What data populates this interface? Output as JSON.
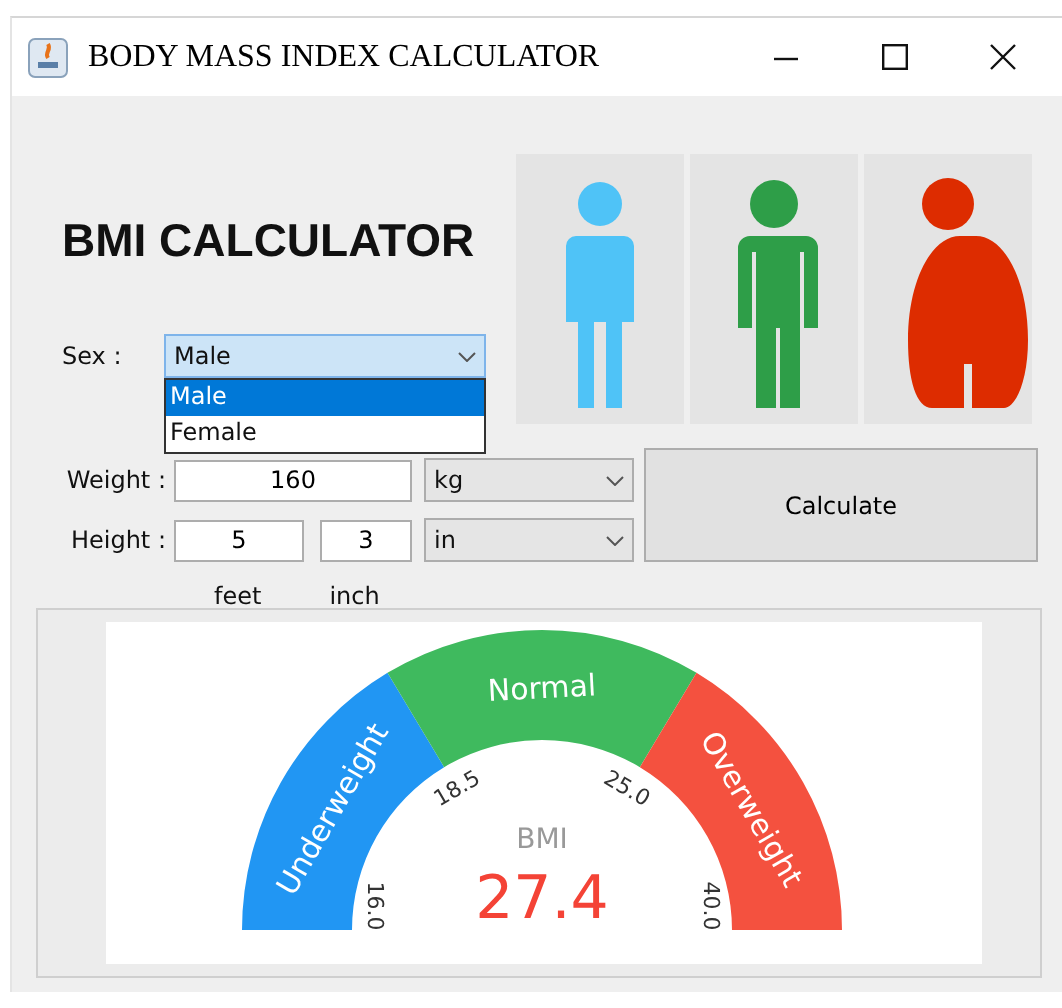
{
  "window": {
    "title": "BODY MASS INDEX CALCULATOR"
  },
  "heading": "BMI CALCULATOR",
  "figures": [
    {
      "kind": "slim",
      "color": "#4fc3f7"
    },
    {
      "kind": "normal",
      "color": "#2e9e48"
    },
    {
      "kind": "heavy",
      "color": "#dd2c00"
    }
  ],
  "sex": {
    "label": "Sex :",
    "value": "Male",
    "expanded": true,
    "options": [
      {
        "label": "Male",
        "selected": true
      },
      {
        "label": "Female",
        "selected": false
      }
    ]
  },
  "weight": {
    "label": "Weight :",
    "value": "160",
    "unit": "kg"
  },
  "height": {
    "label": "Height :",
    "feet": "5",
    "inch": "3",
    "unit": "in",
    "feet_caption": "feet",
    "inch_caption": "inch"
  },
  "calculate_button": "Calculate",
  "gauge": {
    "segments": [
      {
        "label": "Underweight",
        "color": "#2196f3"
      },
      {
        "label": "Normal",
        "color": "#3fba5e"
      },
      {
        "label": "Overweight",
        "color": "#f4513f"
      }
    ],
    "ticks": [
      "16.0",
      "18.5",
      "25.0",
      "40.0"
    ],
    "caption": "BMI",
    "value": "27.4"
  }
}
